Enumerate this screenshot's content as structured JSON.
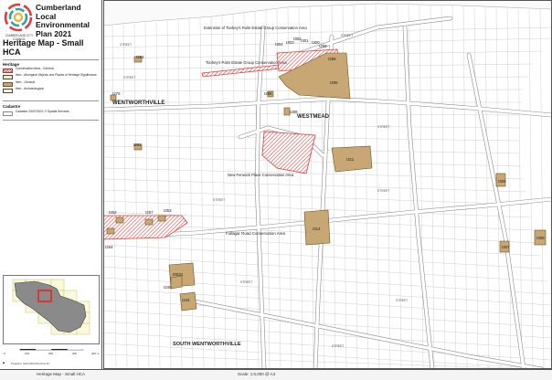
{
  "panel": {
    "council_name": "CUMBERLAND CITY COUNCIL",
    "plan_title": "Cumberland Local Environmental Plan 2021",
    "map_title": "Heritage Map - Small HCA",
    "heritage_heading": "Heritage",
    "legend": [
      {
        "swatch": "conservation",
        "label": "Conservation Area - General"
      },
      {
        "swatch": "aboriginal",
        "label": "Item - Aboriginal Objects and Places of Heritage Significance"
      },
      {
        "swatch": "general",
        "label": "Item - General"
      },
      {
        "swatch": "archaeological",
        "label": "Item - Archaeological"
      }
    ],
    "cadastre_heading": "Cadastre",
    "cadastre_item": "Cadastre 25/07/2021 © Spatial Services",
    "scale_labels": [
      "0",
      "100",
      "200",
      "300",
      "400 m"
    ],
    "projection": "Projection: GDA 1994 MGA Zone 56"
  },
  "strip": {
    "map_name": "Heritage Map - Small HCA",
    "scale": "Scale: 1:5,000 @ A3"
  },
  "colors": {
    "heritage_item": "#c9a774",
    "heritage_item_edge": "#6d5320",
    "conservation_hatch": "#e23b3b",
    "parcel_line": "#b5b5b5",
    "road_line": "#8c8c8c"
  },
  "map": {
    "suburbs": {
      "wentworthville": "WENTWORTHVILLE",
      "westmead": "WESTMEAD",
      "south_wentworthville": "SOUTH WENTWORTHVILLE"
    },
    "conservation_areas": {
      "extension": "Extension of Toohey's Palm Estate Group Conservation Area",
      "tooheys": "Toohey's Palm Estate Group Conservation Area",
      "new_fenwick": "New Fenwick Place Conservation Area",
      "fullagar": "Fullagar Road Conservation Area"
    },
    "items": {
      "i254": "I254",
      "i295": "I295",
      "i298": "I298",
      "i299": "I299",
      "i300": "I300",
      "i301": "I301",
      "i302": "I302",
      "i303": "I303",
      "i304": "I304",
      "i286": "I286",
      "i288": "I288",
      "i276": "I276",
      "i311": "I311",
      "i314": "I314",
      "i261": "I261",
      "i262": "I262",
      "i264": "I264",
      "i257": "I257",
      "i253": "I253",
      "i245": "I245",
      "i244": "I244",
      "i0020": "I0020",
      "i308": "I308",
      "i309": "I309",
      "i307": "I307"
    }
  }
}
